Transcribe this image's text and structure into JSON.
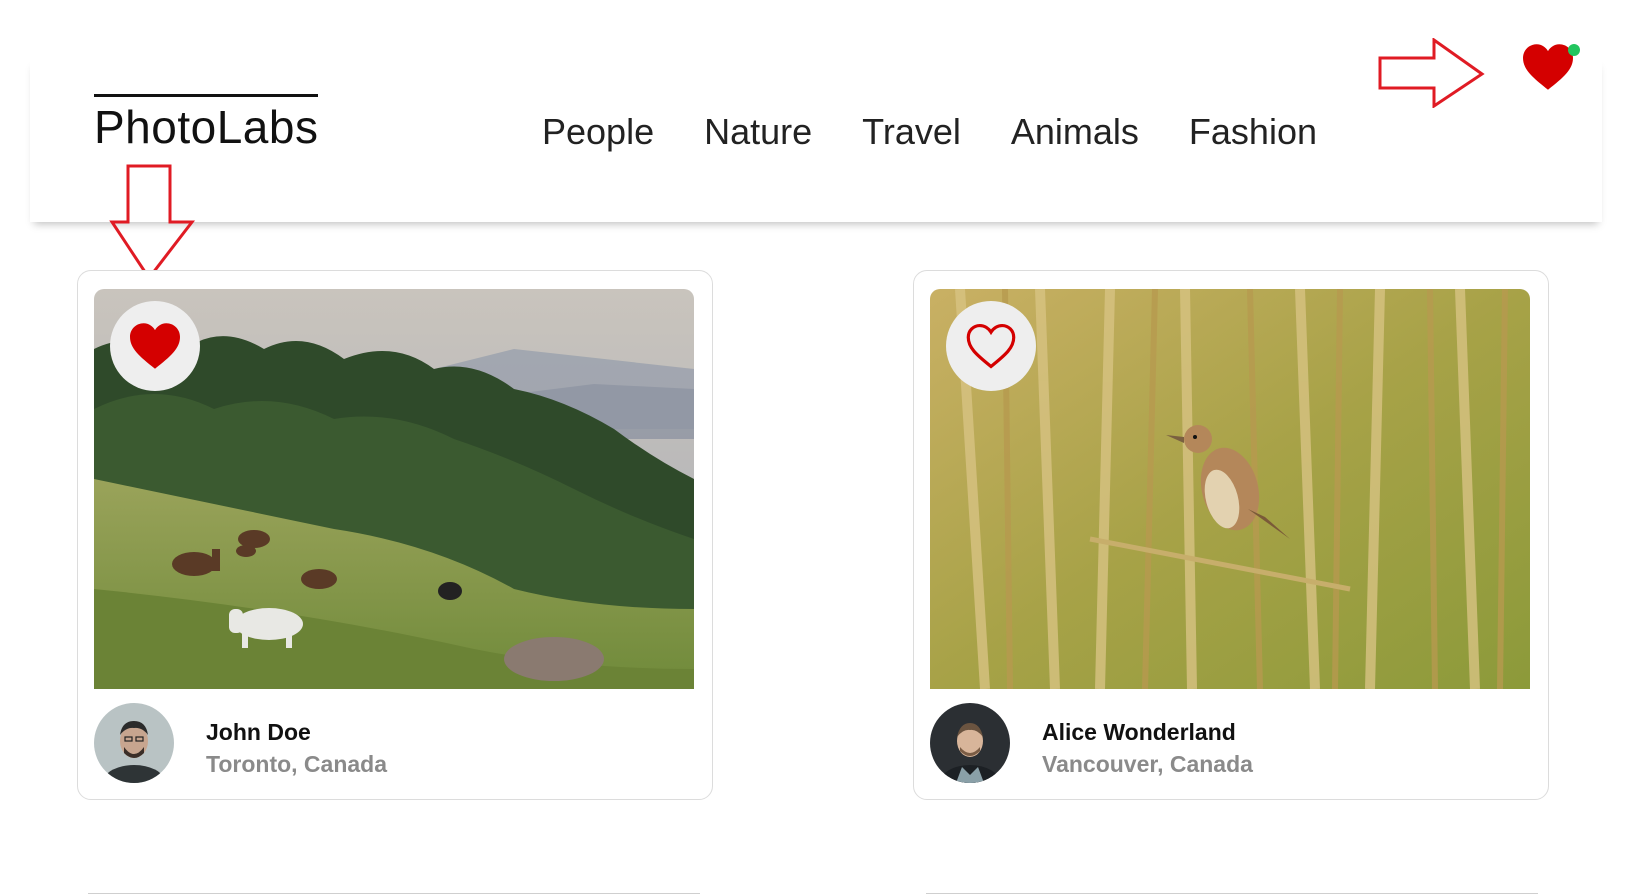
{
  "header": {
    "logo": "PhotoLabs",
    "topics": [
      "People",
      "Nature",
      "Travel",
      "Animals",
      "Fashion"
    ],
    "favorites_icon": "heart-icon",
    "notification_color": "#22c55e"
  },
  "colors": {
    "heart": "#d40000",
    "annotation_arrow": "#e01b24"
  },
  "photos": [
    {
      "favorited": true,
      "description_icon": "heart-icon-filled",
      "user": {
        "name": "John Doe",
        "location": "Toronto, Canada"
      }
    },
    {
      "favorited": false,
      "description_icon": "heart-icon-outline",
      "user": {
        "name": "Alice Wonderland",
        "location": "Vancouver, Canada"
      }
    }
  ]
}
